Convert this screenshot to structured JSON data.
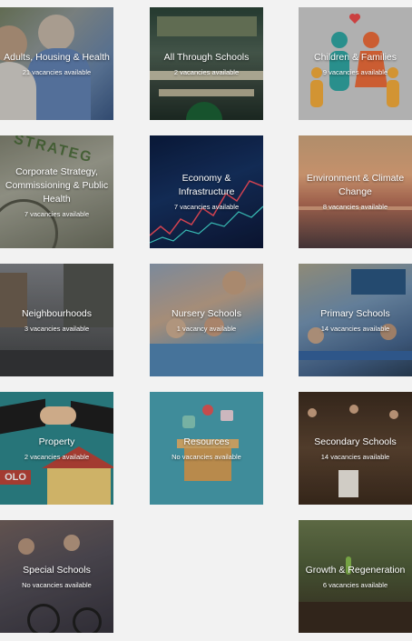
{
  "categories": [
    {
      "title": "Adults, Housing & Health",
      "count": "21 vacancies available"
    },
    {
      "title": "All Through Schools",
      "count": "2 vacancies available"
    },
    {
      "title": "Children & Families",
      "count": "9 vacancies available"
    },
    {
      "title": "Corporate Strategy, Commissioning & Public Health",
      "count": "7 vacancies available"
    },
    {
      "title": "Economy & Infrastructure",
      "count": "7 vacancies available"
    },
    {
      "title": "Environment & Climate Change",
      "count": "8 vacancies available"
    },
    {
      "title": "Neighbourhoods",
      "count": "3 vacancies available"
    },
    {
      "title": "Nursery Schools",
      "count": "1 vacancy available"
    },
    {
      "title": "Primary Schools",
      "count": "14 vacancies available"
    },
    {
      "title": "Property",
      "count": "2 vacancies available"
    },
    {
      "title": "Resources",
      "count": "No vacancies available"
    },
    {
      "title": "Secondary Schools",
      "count": "14 vacancies available"
    },
    {
      "title": "Special Schools",
      "count": "No vacancies available"
    },
    {
      "title": "Growth & Regeneration",
      "count": "6 vacancies available"
    }
  ],
  "strategy_sign_text": "STRATEG",
  "property_sign_text": "OLO"
}
